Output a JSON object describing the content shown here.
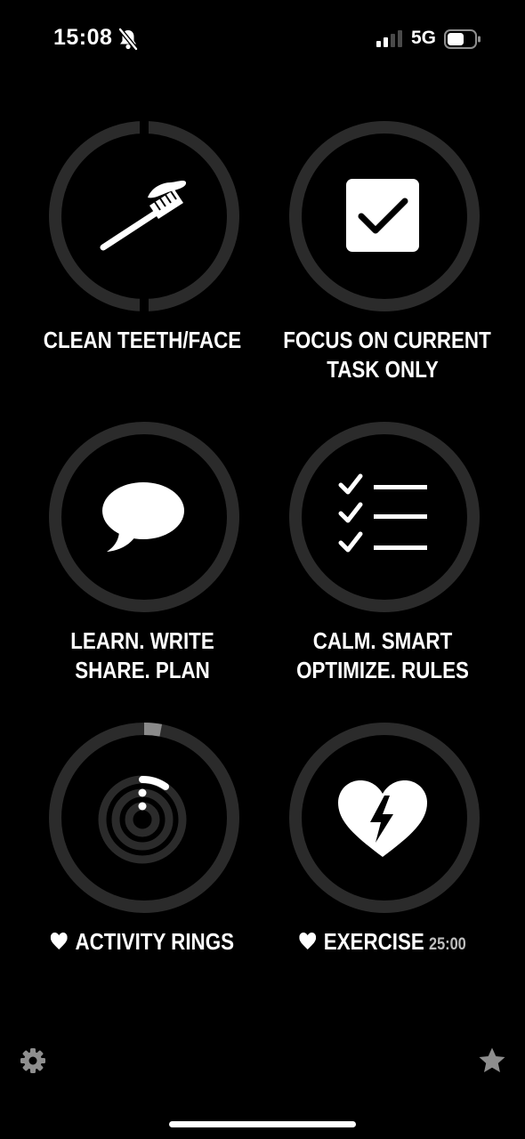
{
  "status_bar": {
    "time": "15:08",
    "network": "5G",
    "icons": [
      "bell-slash-icon",
      "signal-icon",
      "battery-icon"
    ]
  },
  "tiles": [
    {
      "lines": [
        "CLEAN TEETH/FACE"
      ],
      "icon": "toothbrush-icon"
    },
    {
      "lines": [
        "FOCUS ON CURRENT",
        "TASK ONLY"
      ],
      "icon": "checkbox-icon"
    },
    {
      "lines": [
        "LEARN. WRITE",
        "SHARE. PLAN"
      ],
      "icon": "speech-bubble-icon"
    },
    {
      "lines": [
        "CALM. SMART",
        "OPTIMIZE. RULES"
      ],
      "icon": "checklist-icon"
    },
    {
      "lines": [
        "ACTIVITY RINGS"
      ],
      "icon": "activity-rings-icon",
      "heart": true,
      "progress": 0.03
    },
    {
      "lines": [
        "EXERCISE"
      ],
      "icon": "heart-bolt-icon",
      "heart": true,
      "timer": "25:00"
    }
  ],
  "footer": {
    "icons": [
      "gear-icon",
      "star-icon"
    ]
  },
  "colors": {
    "background": "#000000",
    "ring": "#2b2b2b",
    "ring_progress": "#8a8a8a",
    "text": "#ffffff"
  }
}
